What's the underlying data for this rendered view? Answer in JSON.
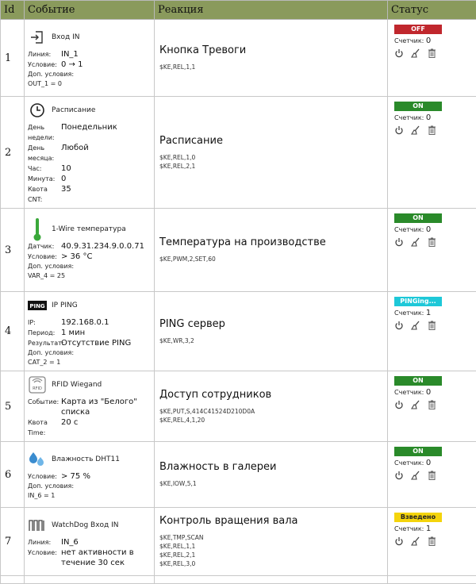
{
  "headers": {
    "id": "Id",
    "event": "Событие",
    "reaction": "Реакция",
    "status": "Статус"
  },
  "rows": [
    {
      "id": "1",
      "event": {
        "title": "Вход IN",
        "icon": "login-icon",
        "fields": [
          {
            "k": "Линия:",
            "v": "IN_1"
          },
          {
            "k": "Условие:",
            "v": "0 → 1"
          }
        ],
        "cond_label": "Доп. условия:",
        "cond": "OUT_1 = 0"
      },
      "reaction": {
        "title": "Кнопка Тревоги",
        "cmds": [
          "$KE,REL,1,1"
        ]
      },
      "status": {
        "label": "OFF",
        "color": "#c0272d",
        "text": "#fff",
        "counter_label": "Счетчик:",
        "counter": "0"
      }
    },
    {
      "id": "2",
      "event": {
        "title": "Расписание",
        "icon": "clock-icon",
        "fields": [
          {
            "k": "День недели:",
            "v": "Понедельник"
          },
          {
            "k": "День месяца:",
            "v": "Любой"
          },
          {
            "k": "Час:",
            "v": "10"
          },
          {
            "k": "Минута:",
            "v": "0"
          },
          {
            "k": "Квота CNT:",
            "v": "35"
          }
        ]
      },
      "reaction": {
        "title": "Расписание",
        "cmds": [
          "$KE,REL,1,0",
          "$KE,REL,2,1"
        ]
      },
      "status": {
        "label": "ON",
        "color": "#2a8a2a",
        "text": "#fff",
        "counter_label": "Счетчик:",
        "counter": "0"
      }
    },
    {
      "id": "3",
      "event": {
        "title": "1-Wire температура",
        "icon": "thermometer-icon",
        "fields": [
          {
            "k": "Датчик:",
            "v": "40.9.31.234.9.0.0.71"
          },
          {
            "k": "Условие:",
            "v": "> 36 °C"
          }
        ],
        "cond_label": "Доп. условия:",
        "cond": "VAR_4 = 25"
      },
      "reaction": {
        "title": "Температура на производстве",
        "cmds": [
          "$KE,PWM,2,SET,60"
        ]
      },
      "status": {
        "label": "ON",
        "color": "#2a8a2a",
        "text": "#fff",
        "counter_label": "Счетчик:",
        "counter": "0"
      }
    },
    {
      "id": "4",
      "event": {
        "title": "IP PING",
        "icon": "ping-icon",
        "icon_text": "PING",
        "fields": [
          {
            "k": "IP:",
            "v": "192.168.0.1"
          },
          {
            "k": "Период:",
            "v": "1 мин"
          },
          {
            "k": "Результат:",
            "v": "Отсутствие PING"
          }
        ],
        "cond_label": "Доп. условия:",
        "cond": "CAT_2 = 1"
      },
      "reaction": {
        "title": "PING сервер",
        "cmds": [
          "$KE,WR,3,2"
        ]
      },
      "status": {
        "label": "PINGing...",
        "color": "#1ec8d8",
        "text": "#fff",
        "counter_label": "Счетчик:",
        "counter": "1"
      }
    },
    {
      "id": "5",
      "event": {
        "title": "RFID Wiegand",
        "icon": "rfid-icon",
        "icon_text": "RFID",
        "fields": [
          {
            "k": "Событие:",
            "v": "Карта из \"Белого\" списка"
          },
          {
            "k": "Квота Time:",
            "v": "20 с"
          }
        ]
      },
      "reaction": {
        "title": "Доступ сотрудников",
        "cmds": [
          "$KE,PUT,S,414C41524D210D0A",
          "$KE,REL,4,1,20"
        ]
      },
      "status": {
        "label": "ON",
        "color": "#2a8a2a",
        "text": "#fff",
        "counter_label": "Счетчик:",
        "counter": "0"
      }
    },
    {
      "id": "6",
      "event": {
        "title": "Влажность DHT11",
        "icon": "humidity-icon",
        "fields": [
          {
            "k": "Условие:",
            "v": "> 75 %"
          }
        ],
        "cond_label": "Доп. условия:",
        "cond": "IN_6 = 1"
      },
      "reaction": {
        "title": "Влажность в галереи",
        "cmds": [
          "$KE,IOW,5,1"
        ]
      },
      "status": {
        "label": "ON",
        "color": "#2a8a2a",
        "text": "#fff",
        "counter_label": "Счетчик:",
        "counter": "0"
      }
    },
    {
      "id": "7",
      "event": {
        "title": "WatchDog Вход IN",
        "icon": "watchdog-icon",
        "fields": [
          {
            "k": "Линия:",
            "v": "IN_6"
          },
          {
            "k": "Условие:",
            "v": "нет активности в течение 30 сек"
          }
        ]
      },
      "reaction": {
        "title": "Контроль вращения вала",
        "cmds": [
          "$KE,TMP,SCAN",
          "$KE,REL,1,1",
          "$KE,REL,2,1",
          "$KE,REL,3,0"
        ]
      },
      "status": {
        "label": "Взведено",
        "color": "#f4d40c",
        "text": "#222",
        "counter_label": "Счетчик:",
        "counter": "1"
      }
    }
  ]
}
